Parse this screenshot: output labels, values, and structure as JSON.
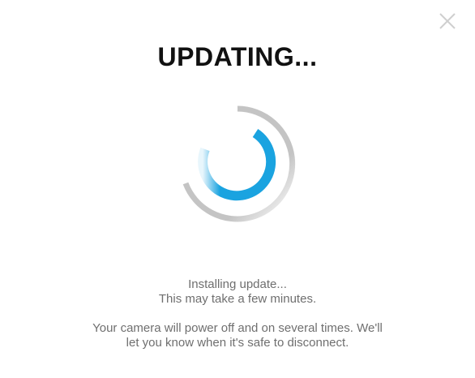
{
  "dialog": {
    "title": "UPDATING...",
    "close_icon": "close-icon",
    "spinner_icon": "loading-spinner",
    "status_lines": [
      "Installing update...",
      "This may take a few minutes."
    ],
    "notice_lines": [
      "Your camera will power off and on several times. We'll",
      "let you know when it's safe to disconnect."
    ]
  },
  "colors": {
    "accent": "#1aa3e0",
    "ring": "#c4c4c4",
    "text": "#6f6f6f",
    "title": "#111111"
  }
}
